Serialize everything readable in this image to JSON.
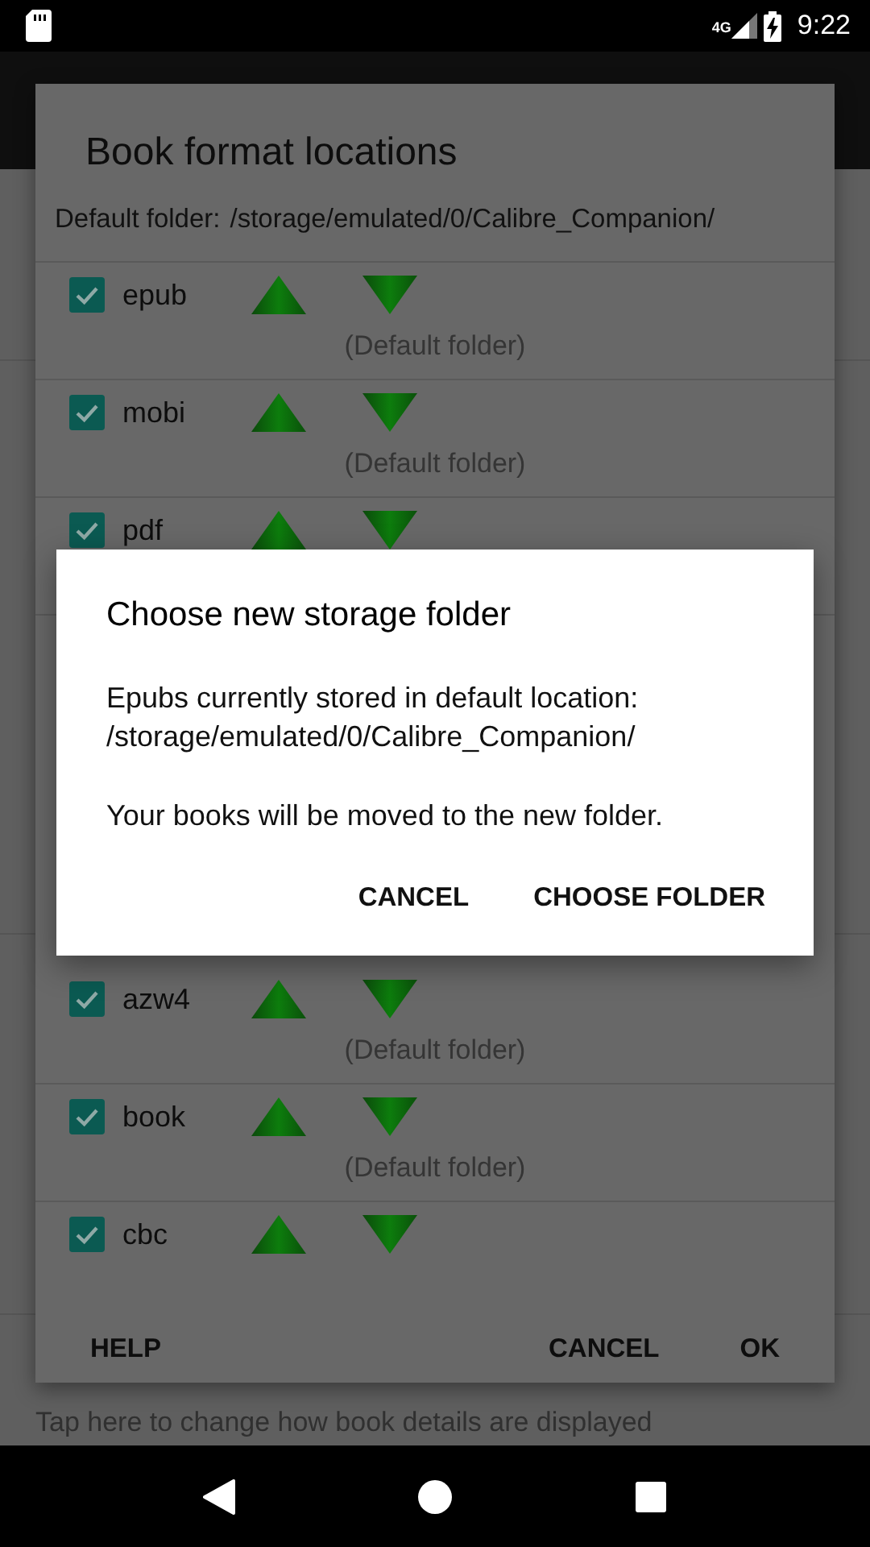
{
  "status_bar": {
    "network": "4G",
    "time": "9:22"
  },
  "dialog": {
    "title": "Book format locations",
    "default_folder_label": "Default folder:",
    "default_folder_path": "/storage/emulated/0/Calibre_Companion/",
    "formats_top": [
      {
        "name": "epub",
        "checked": true,
        "folder": "(Default folder)"
      },
      {
        "name": "mobi",
        "checked": true,
        "folder": "(Default folder)"
      },
      {
        "name": "pdf",
        "checked": true
      }
    ],
    "formats_bottom": [
      {
        "name": "azw4",
        "checked": true,
        "folder": "(Default folder)"
      },
      {
        "name": "book",
        "checked": true,
        "folder": "(Default folder)"
      },
      {
        "name": "cbc",
        "checked": true
      }
    ],
    "buttons": {
      "help": "HELP",
      "cancel": "CANCEL",
      "ok": "OK"
    }
  },
  "prompt": {
    "title": "Choose new storage folder",
    "message": "Epubs currently stored in default location:\n/storage/emulated/0/Calibre_Companion/",
    "note": "Your books will be moved to the new folder.",
    "buttons": [
      "CANCEL",
      "CHOOSE FOLDER"
    ]
  },
  "background": {
    "hint": "Tap here to change how book details are displayed"
  }
}
